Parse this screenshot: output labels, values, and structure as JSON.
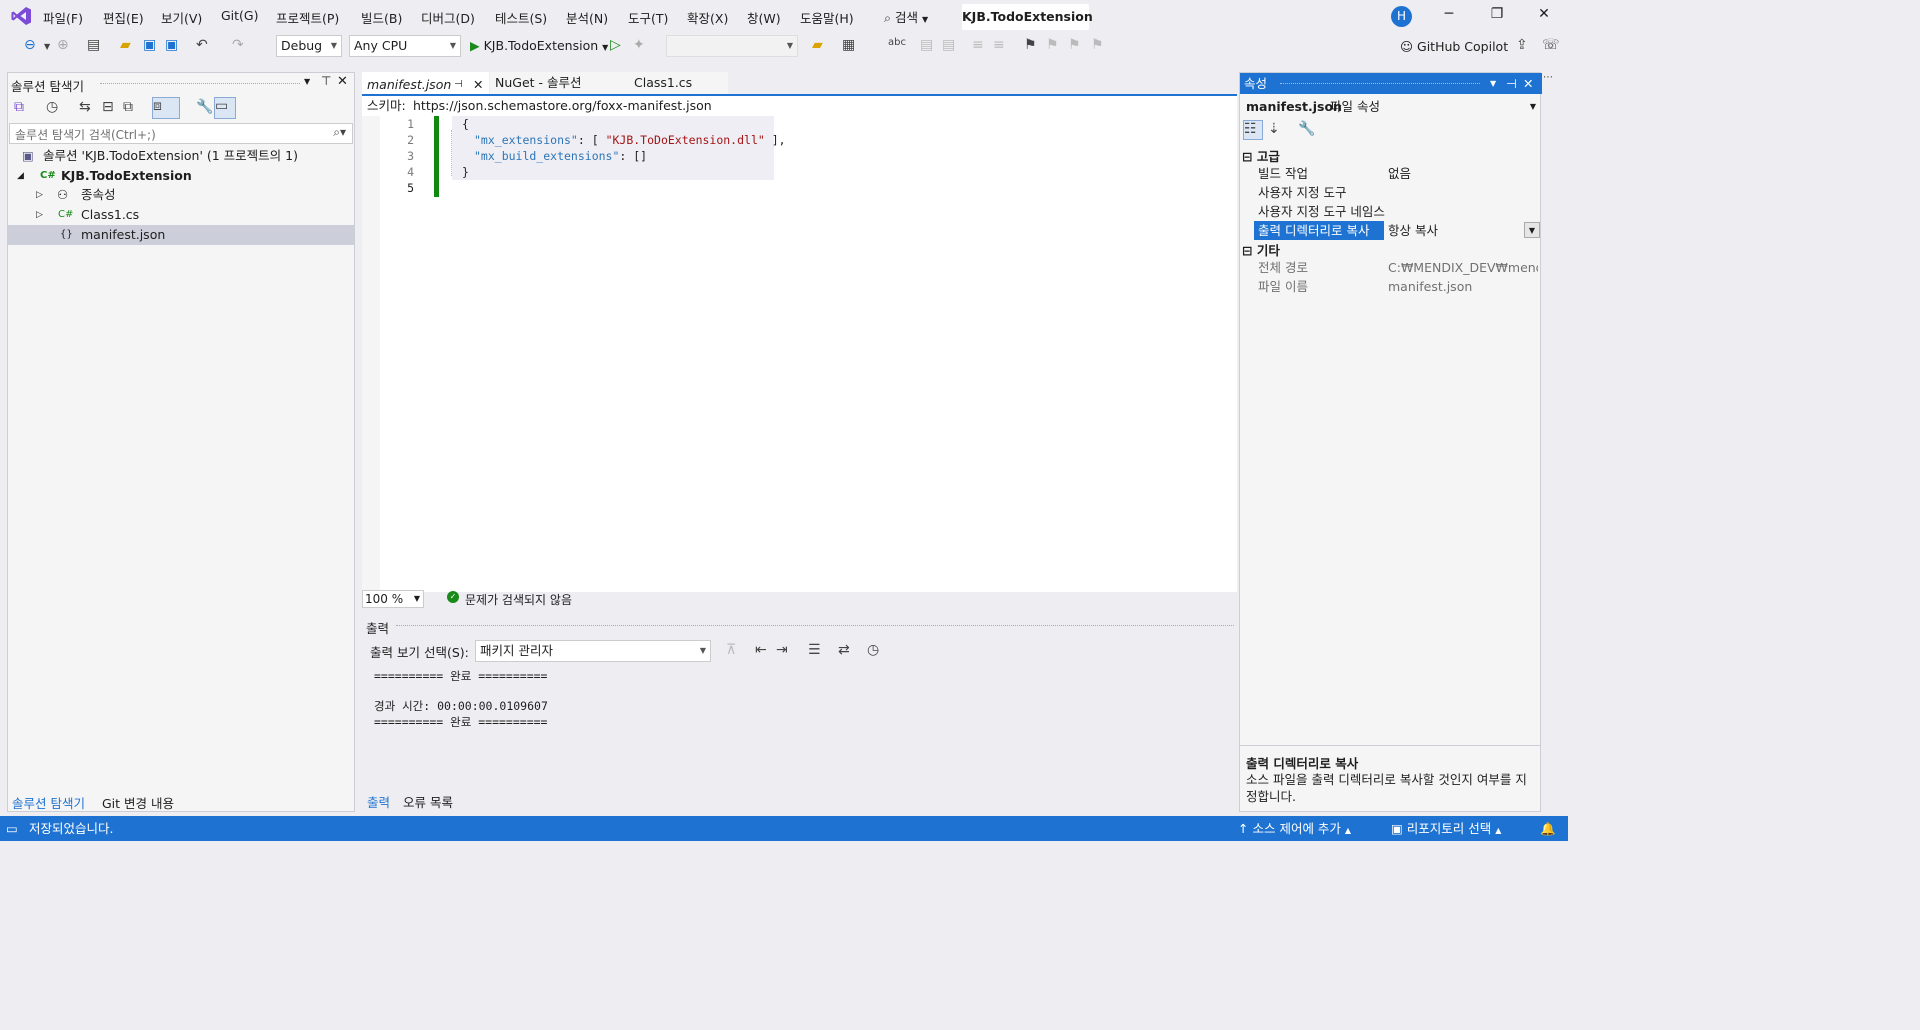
{
  "menu": {
    "items": [
      "파일(F)",
      "편집(E)",
      "보기(V)",
      "Git(G)",
      "프로젝트(P)",
      "빌드(B)",
      "디버그(D)",
      "테스트(S)",
      "분석(N)",
      "도구(T)",
      "확장(X)",
      "창(W)",
      "도움말(H)"
    ],
    "search_label": "검색",
    "solution_title": "KJB.TodoExtension",
    "avatar_letter": "H"
  },
  "toolbar": {
    "config": "Debug",
    "platform": "Any CPU",
    "run_target": "KJB.TodoExtension",
    "copilot": "GitHub Copilot"
  },
  "solution_explorer": {
    "title": "솔루션 탐색기",
    "search_placeholder": "솔루션 탐색기 검색(Ctrl+;)",
    "solution": "솔루션 'KJB.TodoExtension' (1 프로젝트의 1)",
    "project": "KJB.TodoExtension",
    "dependencies": "종속성",
    "class_file": "Class1.cs",
    "manifest_file": "manifest.json",
    "tab_solution": "솔루션 탐색기",
    "tab_git": "Git 변경 내용"
  },
  "editor": {
    "tabs": [
      "manifest.json",
      "NuGet - 솔루션",
      "Class1.cs"
    ],
    "schema_label": "스키마:",
    "schema_url": "https://json.schemastore.org/foxx-manifest.json",
    "line_numbers": [
      "1",
      "2",
      "3",
      "4",
      "5"
    ],
    "code": {
      "l1": "{",
      "l2_key": "\"mx_extensions\"",
      "l2_sep": ": [ ",
      "l2_val": "\"KJB.ToDoExtension.dll\"",
      "l2_end": " ],",
      "l3_key": "\"mx_build_extensions\"",
      "l3_sep": ": []",
      "l4": "}"
    },
    "zoom": "100 %",
    "issues": "문제가 검색되지 않음"
  },
  "output": {
    "title": "출력",
    "select_label": "출력 보기 선택(S):",
    "source": "패키지 관리자",
    "lines": [
      "========== 완료 ==========",
      "",
      "경과 시간: 00:00:00.0109607",
      "========== 완료 =========="
    ],
    "tab_output": "출력",
    "tab_errors": "오류 목록"
  },
  "properties": {
    "title": "속성",
    "object": "manifest.json",
    "object_type": "파일 속성",
    "cat_advanced": "고급",
    "build_action_name": "빌드 작업",
    "build_action_value": "없음",
    "custom_tool_name": "사용자 지정 도구",
    "custom_ns_name": "사용자 지정 도구 네임스",
    "copy_out_name": "출력 디렉터리로 복사",
    "copy_out_value": "항상 복사",
    "cat_misc": "기타",
    "full_path_name": "전체 경로",
    "full_path_value": "C:₩MENDIX_DEV₩mendix-e",
    "file_name_name": "파일 이름",
    "file_name_value": "manifest.json",
    "desc_title": "출력 디렉터리로 복사",
    "desc_text": "소스 파일을 출력 디렉터리로 복사할 것인지 여부를 지정합니다."
  },
  "statusbar": {
    "saved": "저장되었습니다.",
    "source_control": "소스 제어에 추가",
    "repository": "리포지토리 선택"
  }
}
